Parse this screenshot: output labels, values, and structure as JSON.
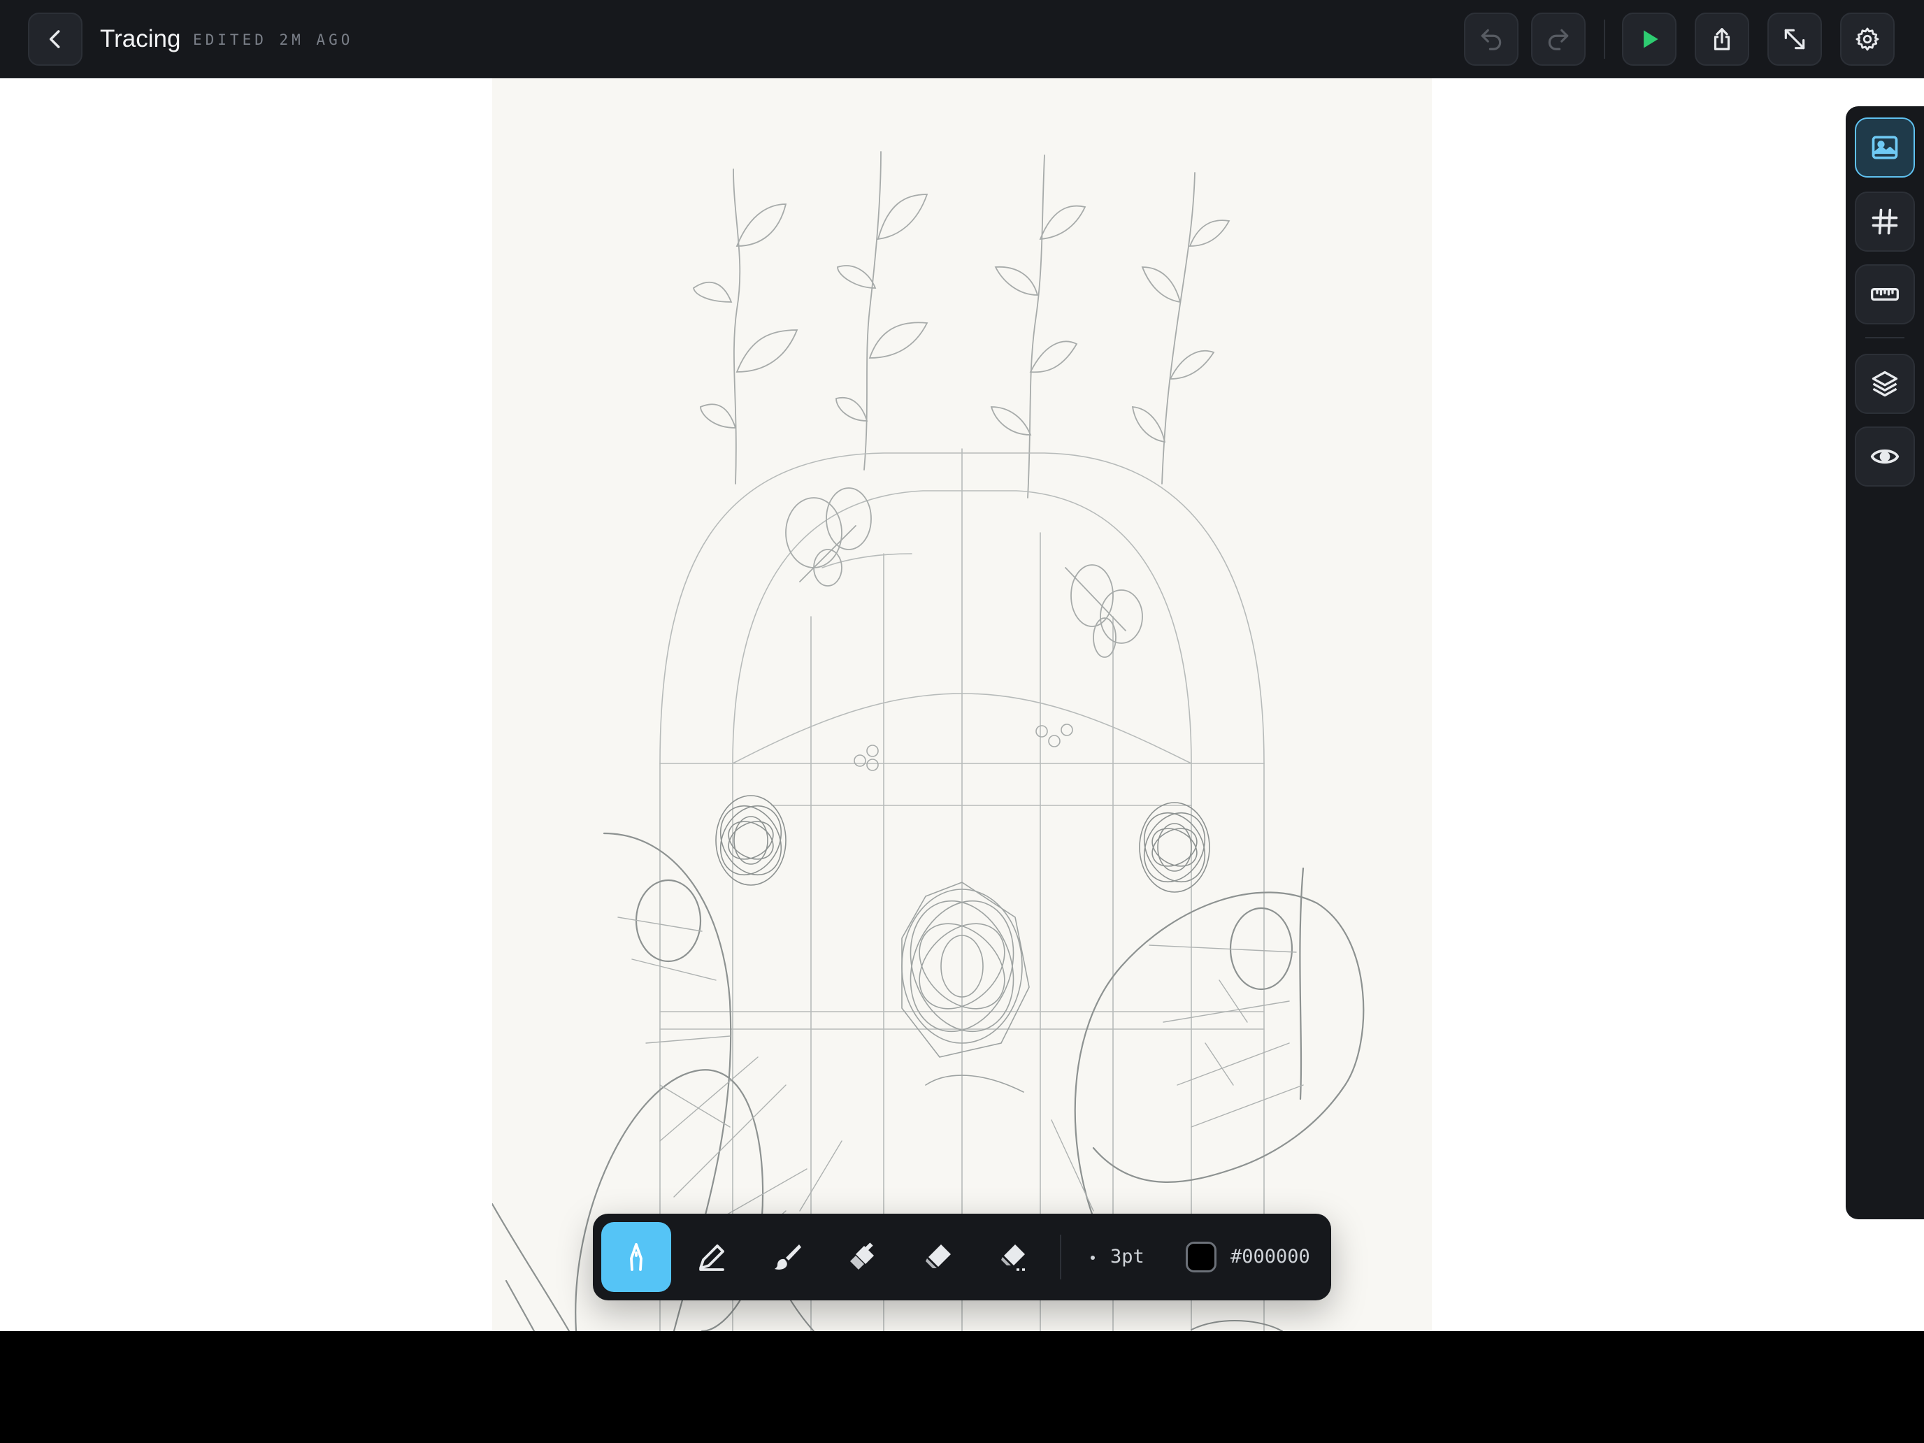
{
  "header": {
    "title": "Tracing",
    "subtitle": "EDITED 2M AGO",
    "buttons": {
      "back": "back-icon",
      "undo": "undo-icon",
      "redo": "redo-icon",
      "play": "play-icon",
      "share": "share-icon",
      "expand": "expand-icon",
      "settings": "gear-icon"
    }
  },
  "right_rail": {
    "items": [
      {
        "name": "image-reference",
        "icon": "image-icon",
        "active": true
      },
      {
        "name": "grid",
        "icon": "grid-icon",
        "active": false
      },
      {
        "name": "ruler",
        "icon": "ruler-icon",
        "active": false
      },
      {
        "name": "layers",
        "icon": "layers-icon",
        "active": false
      },
      {
        "name": "visibility",
        "icon": "eye-icon",
        "active": false
      }
    ]
  },
  "toolbar": {
    "tools": [
      {
        "name": "pen",
        "icon": "fountain-pen-icon",
        "active": true
      },
      {
        "name": "pencil",
        "icon": "pencil-icon",
        "active": false
      },
      {
        "name": "brush",
        "icon": "brush-icon",
        "active": false
      },
      {
        "name": "airbrush",
        "icon": "airbrush-icon",
        "active": false
      },
      {
        "name": "eraser",
        "icon": "eraser-icon",
        "active": false
      },
      {
        "name": "eraser-soft",
        "icon": "eraser-soft-icon",
        "active": false
      }
    ],
    "size": "3pt",
    "color": "#000000",
    "color_label": "#000000"
  },
  "colors": {
    "accent": "#55c4f6",
    "play": "#2ecc71",
    "chrome": "#16181c",
    "paper": "#f8f7f3"
  }
}
